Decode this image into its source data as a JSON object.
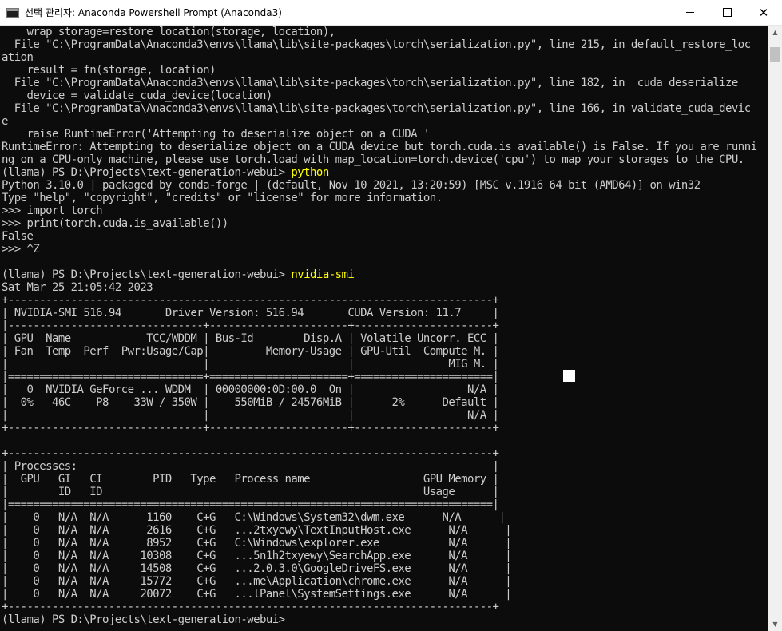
{
  "window": {
    "title": "선택 관리자: Anaconda Powershell Prompt (Anaconda3)",
    "controls": {
      "minimize": "–",
      "maximize": "□",
      "close": "✕"
    }
  },
  "terminal": {
    "lines": [
      {
        "text": "    wrap_storage=restore_location(storage, location),"
      },
      {
        "text": "  File \"C:\\ProgramData\\Anaconda3\\envs\\llama\\lib\\site-packages\\torch\\serialization.py\", line 215, in default_restore_loc"
      },
      {
        "text": "ation"
      },
      {
        "text": "    result = fn(storage, location)"
      },
      {
        "text": "  File \"C:\\ProgramData\\Anaconda3\\envs\\llama\\lib\\site-packages\\torch\\serialization.py\", line 182, in _cuda_deserialize"
      },
      {
        "text": "    device = validate_cuda_device(location)"
      },
      {
        "text": "  File \"C:\\ProgramData\\Anaconda3\\envs\\llama\\lib\\site-packages\\torch\\serialization.py\", line 166, in validate_cuda_devic"
      },
      {
        "text": "e"
      },
      {
        "text": "    raise RuntimeError('Attempting to deserialize object on a CUDA '"
      },
      {
        "text": "RuntimeError: Attempting to deserialize object on a CUDA device but torch.cuda.is_available() is False. If you are runni"
      },
      {
        "text": "ng on a CPU-only machine, please use torch.load with map_location=torch.device('cpu') to map your storages to the CPU."
      },
      {
        "prompt": "(llama) PS D:\\Projects\\text-generation-webui> ",
        "command": "python"
      },
      {
        "text": "Python 3.10.0 | packaged by conda-forge | (default, Nov 10 2021, 13:20:59) [MSC v.1916 64 bit (AMD64)] on win32"
      },
      {
        "text": "Type \"help\", \"copyright\", \"credits\" or \"license\" for more information."
      },
      {
        "text": ">>> import torch"
      },
      {
        "text": ">>> print(torch.cuda.is_available())"
      },
      {
        "text": "False"
      },
      {
        "text": ">>> ^Z"
      },
      {
        "text": ""
      },
      {
        "prompt": "(llama) PS D:\\Projects\\text-generation-webui> ",
        "command": "nvidia-smi"
      },
      {
        "text": "Sat Mar 25 21:05:42 2023"
      },
      {
        "text": "+-----------------------------------------------------------------------------+"
      },
      {
        "text": "| NVIDIA-SMI 516.94       Driver Version: 516.94       CUDA Version: 11.7     |"
      },
      {
        "text": "|-------------------------------+----------------------+----------------------+"
      },
      {
        "text": "| GPU  Name            TCC/WDDM | Bus-Id        Disp.A | Volatile Uncorr. ECC |"
      },
      {
        "text": "| Fan  Temp  Perf  Pwr:Usage/Cap|         Memory-Usage | GPU-Util  Compute M. |"
      },
      {
        "text": "|                               |                      |               MIG M. |"
      },
      {
        "text": "|===============================+======================+======================|"
      },
      {
        "text": "|   0  NVIDIA GeForce ... WDDM  | 00000000:0D:00.0  On |                  N/A |"
      },
      {
        "text": "|  0%   46C    P8    33W / 350W |    550MiB / 24576MiB |      2%      Default |"
      },
      {
        "text": "|                               |                      |                  N/A |"
      },
      {
        "text": "+-------------------------------+----------------------+----------------------+"
      },
      {
        "text": ""
      },
      {
        "text": "+-----------------------------------------------------------------------------+"
      },
      {
        "text": "| Processes:                                                                  |"
      },
      {
        "text": "|  GPU   GI   CI        PID   Type   Process name                  GPU Memory |"
      },
      {
        "text": "|        ID   ID                                                   Usage      |"
      },
      {
        "text": "|=============================================================================|"
      },
      {
        "text": "|    0   N/A  N/A      1160    C+G   C:\\Windows\\System32\\dwm.exe      N/A      |"
      },
      {
        "text": "|    0   N/A  N/A      2616    C+G   ...2txyewy\\TextInputHost.exe      N/A      |"
      },
      {
        "text": "|    0   N/A  N/A      8952    C+G   C:\\Windows\\explorer.exe           N/A      |"
      },
      {
        "text": "|    0   N/A  N/A     10308    C+G   ...5n1h2txyewy\\SearchApp.exe      N/A      |"
      },
      {
        "text": "|    0   N/A  N/A     14508    C+G   ...2.0.3.0\\GoogleDriveFS.exe      N/A      |"
      },
      {
        "text": "|    0   N/A  N/A     15772    C+G   ...me\\Application\\chrome.exe      N/A      |"
      },
      {
        "text": "|    0   N/A  N/A     20072    C+G   ...lPanel\\SystemSettings.exe      N/A      |"
      },
      {
        "text": "+-----------------------------------------------------------------------------+"
      },
      {
        "prompt": "(llama) PS D:\\Projects\\text-generation-webui> ",
        "command": ""
      }
    ]
  },
  "scrollbar": {
    "up_arrow": "▲",
    "down_arrow": "▼"
  }
}
